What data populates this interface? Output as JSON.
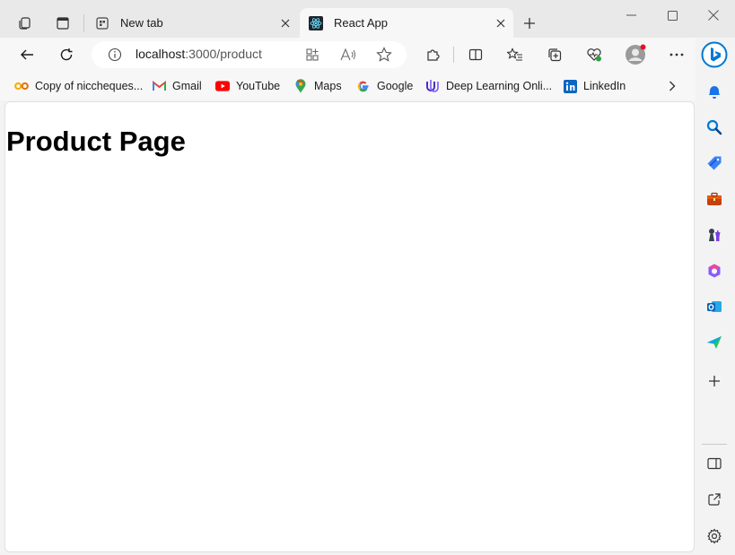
{
  "tabs": [
    {
      "title": "New tab",
      "active": false
    },
    {
      "title": "React App",
      "active": true
    }
  ],
  "address": {
    "host": "localhost",
    "path": ":3000/product"
  },
  "bookmarks": [
    {
      "label": "Copy of niccheques...",
      "icon": "colab-icon"
    },
    {
      "label": "Gmail",
      "icon": "gmail-icon"
    },
    {
      "label": "YouTube",
      "icon": "youtube-icon"
    },
    {
      "label": "Maps",
      "icon": "maps-icon"
    },
    {
      "label": "Google",
      "icon": "google-icon"
    },
    {
      "label": "Deep Learning Onli...",
      "icon": "udemy-icon"
    },
    {
      "label": "LinkedIn",
      "icon": "linkedin-icon"
    }
  ],
  "page": {
    "heading": "Product Page"
  },
  "colors": {
    "accent": "#0078d4",
    "profile_dot": "#e81123",
    "youtube": "#ff0000",
    "linkedin": "#0a66c2"
  }
}
